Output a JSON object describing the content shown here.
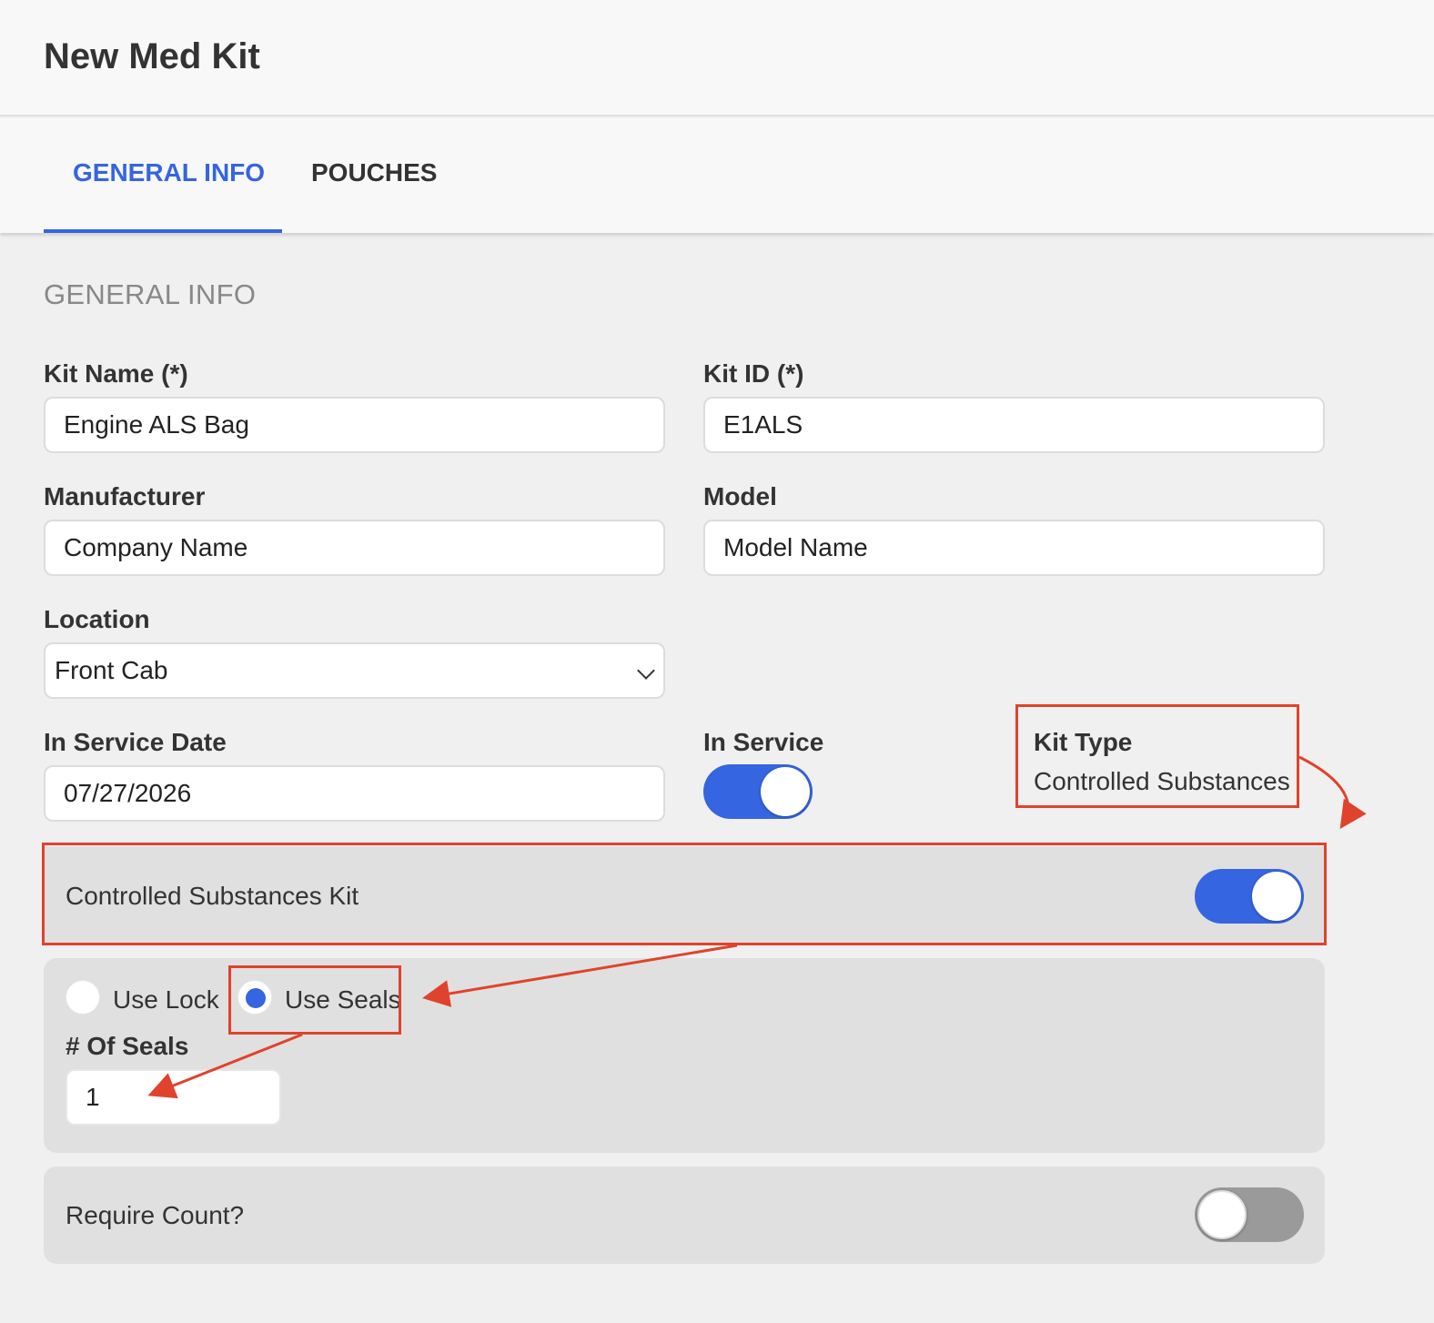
{
  "header": {
    "title": "New Med Kit"
  },
  "tabs": [
    {
      "label": "GENERAL INFO",
      "active": true
    },
    {
      "label": "POUCHES",
      "active": false
    }
  ],
  "section": {
    "title": "GENERAL INFO"
  },
  "form": {
    "kit_name": {
      "label": "Kit Name (*)",
      "value": "Engine ALS Bag"
    },
    "kit_id": {
      "label": "Kit ID (*)",
      "value": "E1ALS"
    },
    "manufacturer": {
      "label": "Manufacturer",
      "value": "Company Name"
    },
    "model": {
      "label": "Model",
      "value": "Model Name"
    },
    "location": {
      "label": "Location",
      "value": "Front Cab"
    },
    "in_service_date": {
      "label": "In Service Date",
      "value": "07/27/2026"
    },
    "in_service": {
      "label": "In Service",
      "checked": true
    },
    "kit_type": {
      "label": "Kit Type",
      "value": "Controlled Substances"
    }
  },
  "controlled": {
    "label": "Controlled Substances Kit",
    "checked": true
  },
  "security": {
    "options": [
      {
        "label": "Use Lock",
        "checked": false
      },
      {
        "label": "Use Seals",
        "checked": true
      }
    ],
    "seals_label": "# Of Seals",
    "seals_value": "1"
  },
  "require_count": {
    "label": "Require Count?",
    "checked": false
  },
  "colors": {
    "accent": "#3565e0",
    "annotation": "#e0432b",
    "toggle_off": "#9a9a9a"
  }
}
